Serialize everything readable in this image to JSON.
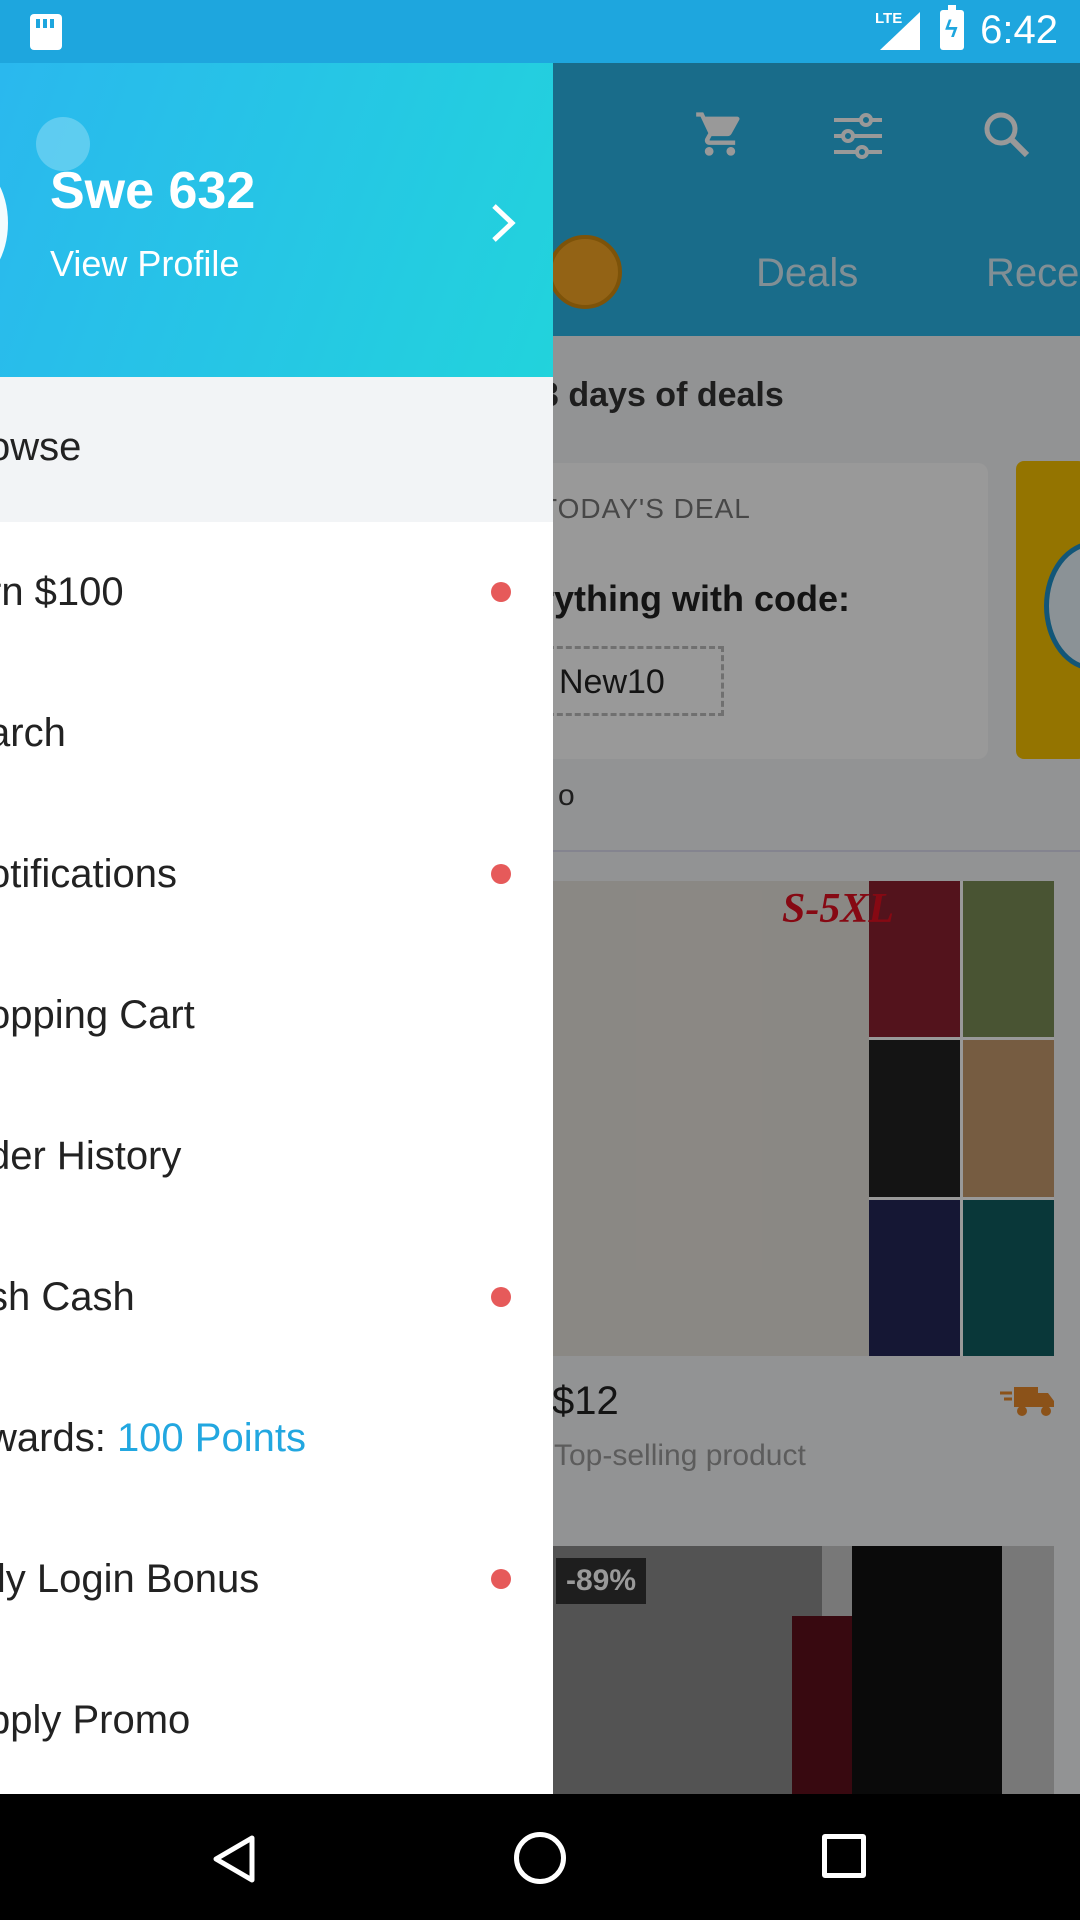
{
  "status_bar": {
    "time": "6:42",
    "network": "LTE"
  },
  "background": {
    "tabs": [
      "Deals",
      "Rece"
    ],
    "deals_heading": "3 days of deals",
    "deal_card": {
      "label": "TODAY'S DEAL",
      "text": "rything with code:",
      "code": "New10"
    },
    "see_all": "o",
    "product1": {
      "size_text": "S-5XL",
      "price": "$12",
      "subtitle": "Top-selling product"
    },
    "product2": {
      "discount": "-89%"
    }
  },
  "drawer": {
    "username": "Swe 632",
    "view_profile": "View Profile",
    "items": [
      {
        "label": "owse",
        "selected": true,
        "dot": false
      },
      {
        "label": "rn $100",
        "dot": true
      },
      {
        "label": "arch",
        "dot": false
      },
      {
        "label": "otifications",
        "dot": true
      },
      {
        "label": "opping Cart",
        "dot": false
      },
      {
        "label": "der History",
        "dot": false
      },
      {
        "label": "sh Cash",
        "dot": true
      },
      {
        "label": "wards: ",
        "accent": "100 Points",
        "dot": false
      },
      {
        "label": "ily Login Bonus",
        "dot": true
      },
      {
        "label": "pply Promo",
        "dot": false
      }
    ]
  },
  "colors": {
    "header_start": "#2ab8ee",
    "header_end": "#22d3dc",
    "accent": "#22a7e0",
    "dot": "#e65a5a"
  }
}
